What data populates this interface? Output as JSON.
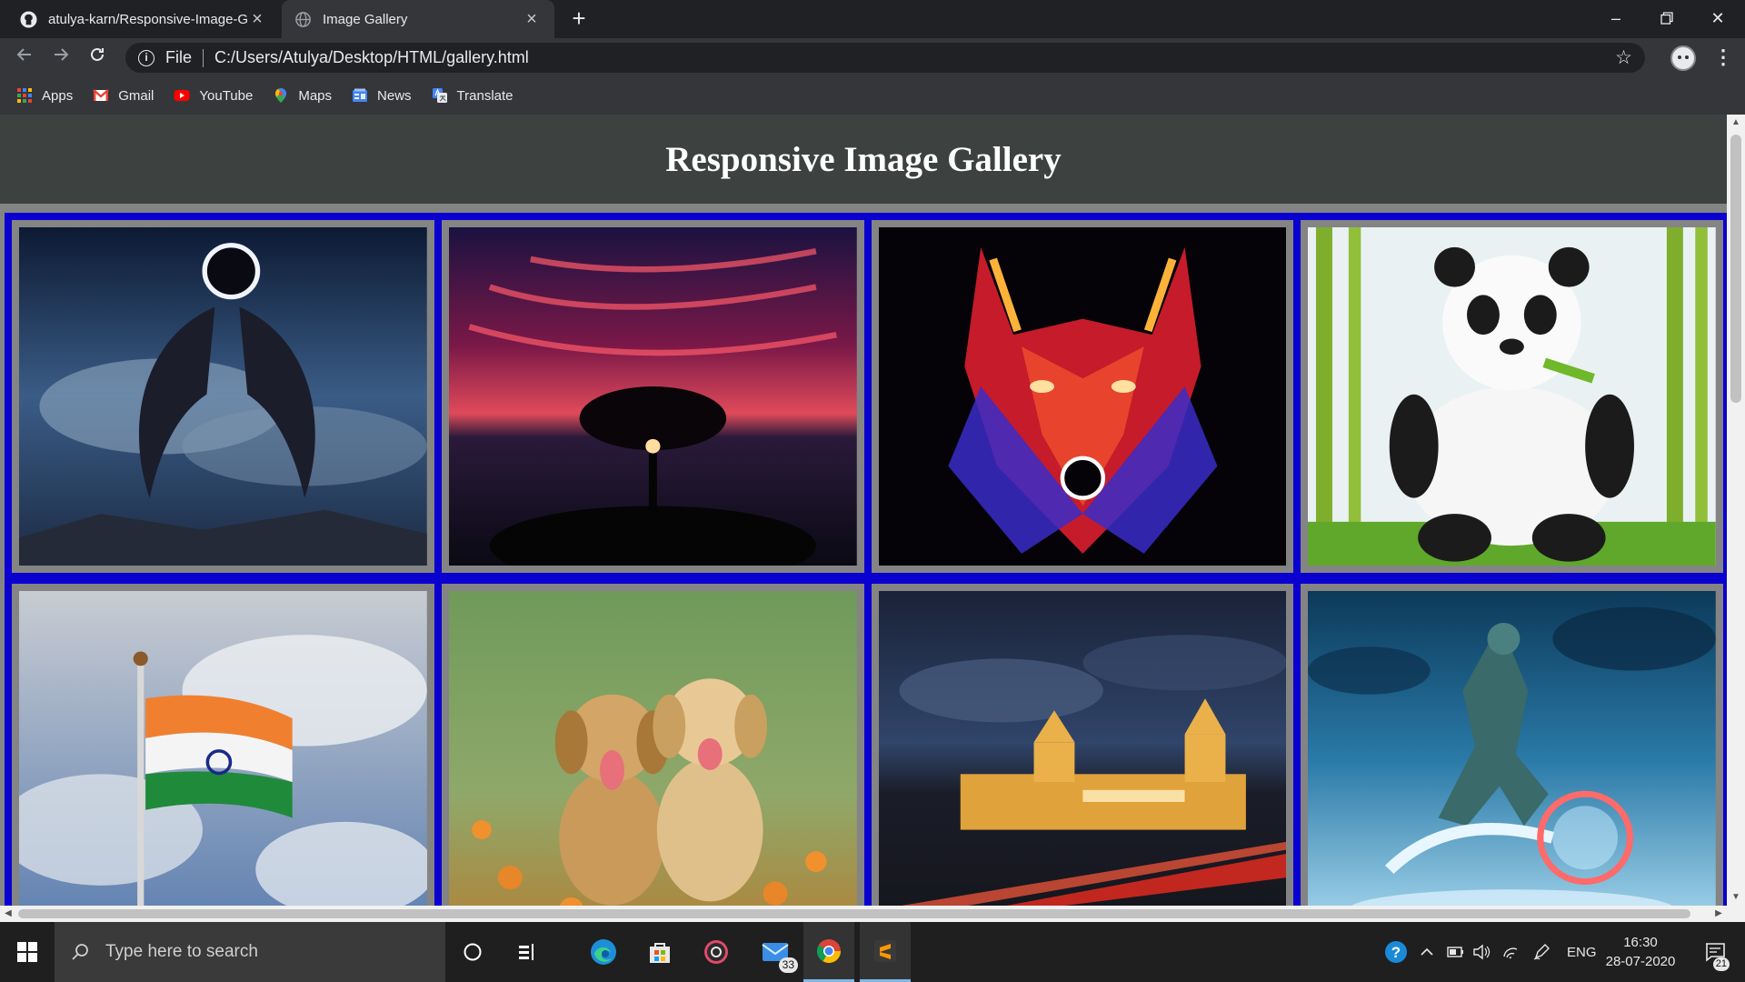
{
  "browser": {
    "tabs": [
      {
        "title": "atulya-karn/Responsive-Image-G",
        "icon": "github-icon",
        "active": false
      },
      {
        "title": "Image Gallery",
        "icon": "globe-icon",
        "active": true
      }
    ],
    "address": {
      "scheme_label": "File",
      "url": "C:/Users/Atulya/Desktop/HTML/gallery.html"
    },
    "bookmarks": [
      {
        "label": "Apps",
        "icon": "apps-grid-icon"
      },
      {
        "label": "Gmail",
        "icon": "gmail-icon"
      },
      {
        "label": "YouTube",
        "icon": "youtube-icon"
      },
      {
        "label": "Maps",
        "icon": "maps-icon"
      },
      {
        "label": "News",
        "icon": "news-icon"
      },
      {
        "label": "Translate",
        "icon": "translate-icon"
      }
    ]
  },
  "page": {
    "title": "Responsive Image Gallery",
    "gallery_images": [
      {
        "subject": "angel-wings-eclipse"
      },
      {
        "subject": "tree-sunset"
      },
      {
        "subject": "neon-wolf"
      },
      {
        "subject": "panda-bamboo"
      },
      {
        "subject": "indian-flag"
      },
      {
        "subject": "puppies"
      },
      {
        "subject": "palace-night"
      },
      {
        "subject": "robot-warrior"
      }
    ],
    "colors": {
      "header_bg": "#3d4241",
      "gallery_bg": "#0a00cf",
      "card_bg": "#848484"
    }
  },
  "taskbar": {
    "search_placeholder": "Type here to search",
    "mail_badge": "33",
    "language": "ENG",
    "time": "16:30",
    "date": "28-07-2020",
    "notification_count": "21"
  }
}
